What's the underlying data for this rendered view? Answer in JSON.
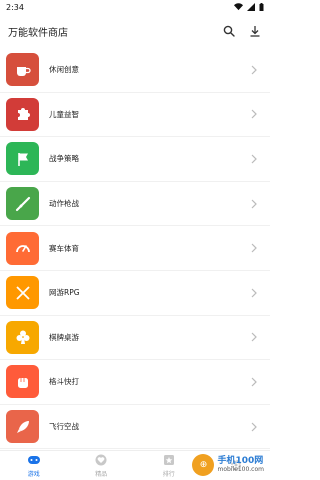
{
  "status_bar": {
    "time": "2:34"
  },
  "app_bar": {
    "title": "万能软件商店"
  },
  "categories": [
    {
      "label": "休闲创意",
      "color": "#d64f3c",
      "icon": "coffee-cup-icon"
    },
    {
      "label": "儿童益智",
      "color": "#d23c38",
      "icon": "puzzle-icon"
    },
    {
      "label": "战争策略",
      "color": "#2db657",
      "icon": "flag-icon"
    },
    {
      "label": "动作枪战",
      "color": "#49a64a",
      "icon": "rifle-icon"
    },
    {
      "label": "赛车体育",
      "color": "#ff6b35",
      "icon": "speedometer-icon"
    },
    {
      "label": "网游RPG",
      "color": "#ff9800",
      "icon": "crossed-swords-icon"
    },
    {
      "label": "棋牌桌游",
      "color": "#f7a800",
      "icon": "club-card-icon"
    },
    {
      "label": "格斗快打",
      "color": "#ff5b3a",
      "icon": "fist-icon"
    },
    {
      "label": "飞行空战",
      "color": "#e9654a",
      "icon": "rocket-icon"
    }
  ],
  "bottom_nav": [
    {
      "label": "游戏",
      "icon": "gamepad-icon",
      "active": true
    },
    {
      "label": "精品",
      "icon": "heart-badge-icon",
      "active": false
    },
    {
      "label": "排行",
      "icon": "rank-icon",
      "active": false
    },
    {
      "label": "",
      "icon": "gear-icon",
      "active": false
    }
  ],
  "watermark": {
    "title": "手机100网",
    "subtitle": "mobile100.com"
  },
  "colors": {
    "accent": "#1a73e8",
    "text": "#222222",
    "inactive": "#aaaaaa"
  }
}
